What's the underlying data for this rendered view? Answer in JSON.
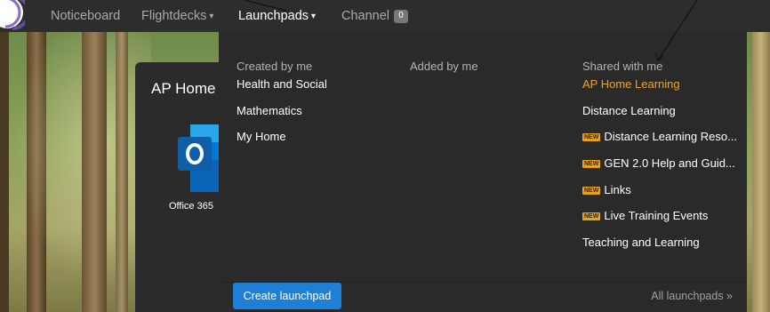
{
  "navbar": {
    "items": [
      {
        "label": "Noticeboard"
      },
      {
        "label": "Flightdecks",
        "caret": "▾"
      },
      {
        "label": "Launchpads",
        "caret": "▾"
      },
      {
        "label": "Channel",
        "badge": "0"
      }
    ]
  },
  "background_card": {
    "title": "AP Home",
    "app_label": "Office 365",
    "app_icon": "outlook-icon"
  },
  "dropdown": {
    "columns": [
      {
        "heading": "Created by me",
        "items": [
          "Health and Social",
          "Mathematics",
          "My Home"
        ]
      },
      {
        "heading": "Added by me",
        "items": []
      },
      {
        "heading": "Shared with me",
        "items": [
          {
            "label": "AP Home Learning",
            "is_new": false,
            "highlight": true
          },
          {
            "label": "Distance Learning",
            "is_new": false,
            "highlight": false
          },
          {
            "label": "Distance Learning Reso...",
            "is_new": true,
            "highlight": false
          },
          {
            "label": "GEN 2.0 Help and Guid...",
            "is_new": true,
            "highlight": false
          },
          {
            "label": "Links",
            "is_new": true,
            "highlight": false
          },
          {
            "label": "Live Training Events",
            "is_new": true,
            "highlight": false
          },
          {
            "label": "Teaching and Learning",
            "is_new": false,
            "highlight": false
          }
        ]
      }
    ],
    "new_tag": "NEW",
    "create_button": "Create launchpad",
    "all_link": "All launchpads »"
  },
  "colors": {
    "navbar_bg": "#2d2d2d",
    "dropdown_bg": "#2a2a2a",
    "highlight": "#f0a32a",
    "button_bg": "#1e7fd6",
    "new_tag_bg": "#e8a020"
  }
}
